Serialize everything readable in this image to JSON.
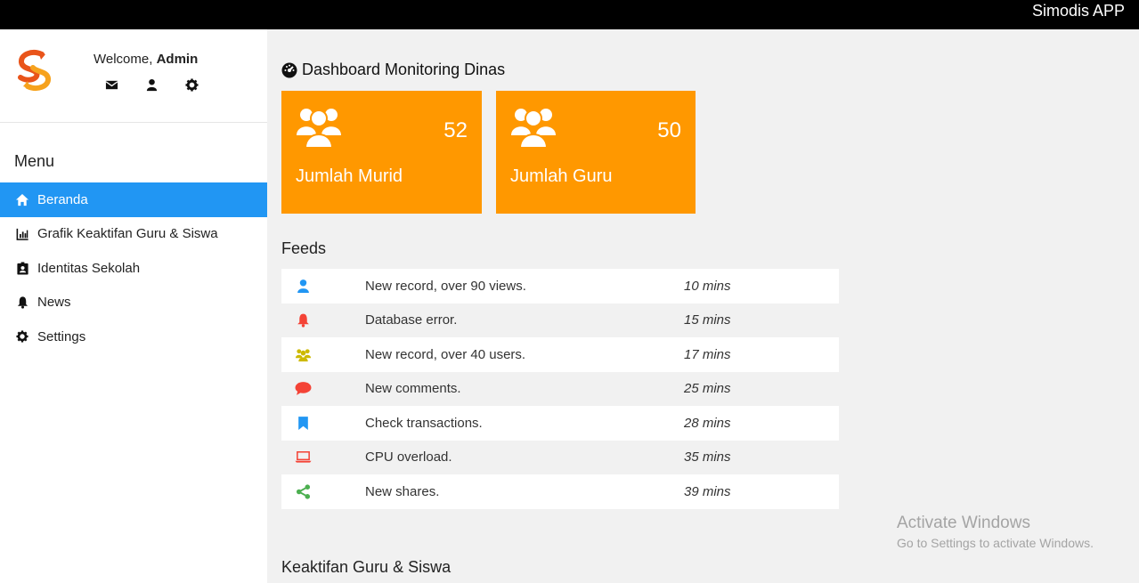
{
  "app": {
    "title": "Simodis APP"
  },
  "user": {
    "welcome_prefix": "Welcome,",
    "name": "Admin"
  },
  "user_icons": [
    "envelope-icon",
    "user-icon",
    "gear-icon"
  ],
  "sidebar": {
    "menu_heading": "Menu",
    "items": [
      {
        "label": "Beranda",
        "icon": "home-icon",
        "active": true
      },
      {
        "label": "Grafik Keaktifan Guru & Siswa",
        "icon": "bar-chart-icon",
        "active": false
      },
      {
        "label": "Identitas Sekolah",
        "icon": "id-badge-icon",
        "active": false
      },
      {
        "label": "News",
        "icon": "bell-icon",
        "active": false
      },
      {
        "label": "Settings",
        "icon": "gear-icon",
        "active": false
      }
    ]
  },
  "dashboard": {
    "title": "Dashboard Monitoring Dinas",
    "cards": [
      {
        "label": "Jumlah Murid",
        "value": "52",
        "icon": "users-icon",
        "color": "#ff9800"
      },
      {
        "label": "Jumlah Guru",
        "value": "50",
        "icon": "users-icon",
        "color": "#ff9800"
      }
    ]
  },
  "feeds": {
    "title": "Feeds",
    "items": [
      {
        "icon": "user-icon",
        "color": "#2196f3",
        "text": "New record, over 90 views.",
        "time": "10 mins"
      },
      {
        "icon": "bell-icon",
        "color": "#f44336",
        "text": "Database error.",
        "time": "15 mins"
      },
      {
        "icon": "users-icon",
        "color": "#cdb900",
        "text": "New record, over 40 users.",
        "time": "17 mins"
      },
      {
        "icon": "comment-icon",
        "color": "#f44336",
        "text": "New comments.",
        "time": "25 mins"
      },
      {
        "icon": "bookmark-icon",
        "color": "#2196f3",
        "text": "Check transactions.",
        "time": "28 mins"
      },
      {
        "icon": "laptop-icon",
        "color": "#f44336",
        "text": "CPU overload.",
        "time": "35 mins"
      },
      {
        "icon": "share-icon",
        "color": "#4caf50",
        "text": "New shares.",
        "time": "39 mins"
      }
    ]
  },
  "section2": {
    "title": "Keaktifan Guru & Siswa"
  },
  "watermark": {
    "line1": "Activate Windows",
    "line2": "Go to Settings to activate Windows."
  }
}
